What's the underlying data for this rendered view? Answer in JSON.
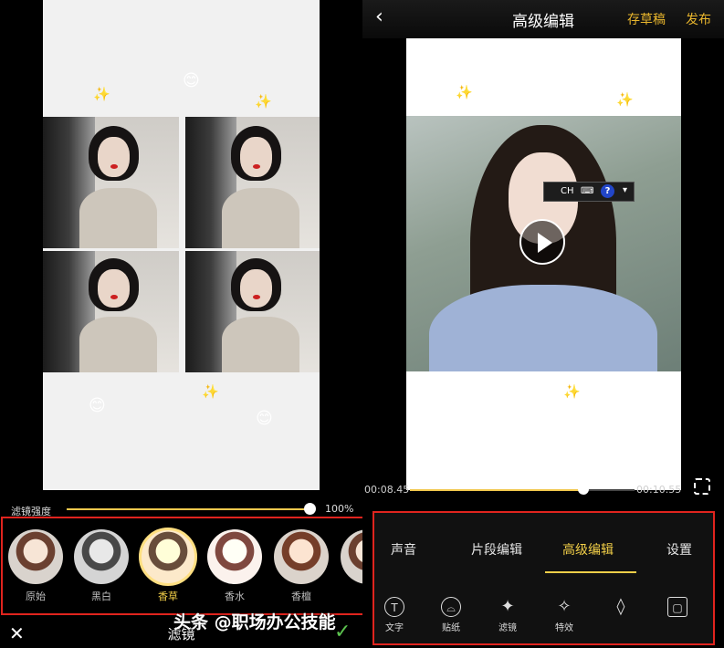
{
  "left": {
    "strength_label": "滤镜强度",
    "strength_value": "100%",
    "strength_level": 1.0,
    "filters": [
      {
        "name": "原始",
        "selected": false
      },
      {
        "name": "黑白",
        "selected": false
      },
      {
        "name": "香草",
        "selected": true
      },
      {
        "name": "香水",
        "selected": false
      },
      {
        "name": "香檀",
        "selected": false
      },
      {
        "name": "",
        "selected": false
      }
    ],
    "bottom_title": "滤镜",
    "close_icon": "close-icon",
    "confirm_icon": "check-icon",
    "decorations": [
      "😊",
      "✨",
      "✨",
      "😊",
      "✨",
      "😊"
    ]
  },
  "right": {
    "title": "高级编辑",
    "draft_label": "存草稿",
    "publish_label": "发布",
    "back_icon": "chevron-left-icon",
    "ime": {
      "lang": "CH",
      "help": "?"
    },
    "decorations": [
      "😘",
      "✨",
      "✨",
      "😘",
      "✨",
      "😘"
    ],
    "time_start": "00:08.45",
    "time_end": "00:10.55",
    "progress": 0.8,
    "tabs": [
      {
        "label": "声音",
        "active": false
      },
      {
        "label": "片段编辑",
        "active": false
      },
      {
        "label": "高级编辑",
        "active": true
      },
      {
        "label": "设置",
        "active": false
      }
    ],
    "tools": [
      {
        "label": "文字",
        "icon": "T"
      },
      {
        "label": "贴纸",
        "icon": "⌓"
      },
      {
        "label": "滤镜",
        "icon": "✦"
      },
      {
        "label": "特效",
        "icon": "✧"
      },
      {
        "label": "",
        "icon": "◊"
      },
      {
        "label": "",
        "icon": "▢"
      }
    ]
  },
  "watermark": "头条 @职场办公技能",
  "colors": {
    "accent": "#f2cf48",
    "highlight_box": "#e0241e",
    "confirm": "#5cc34f"
  }
}
